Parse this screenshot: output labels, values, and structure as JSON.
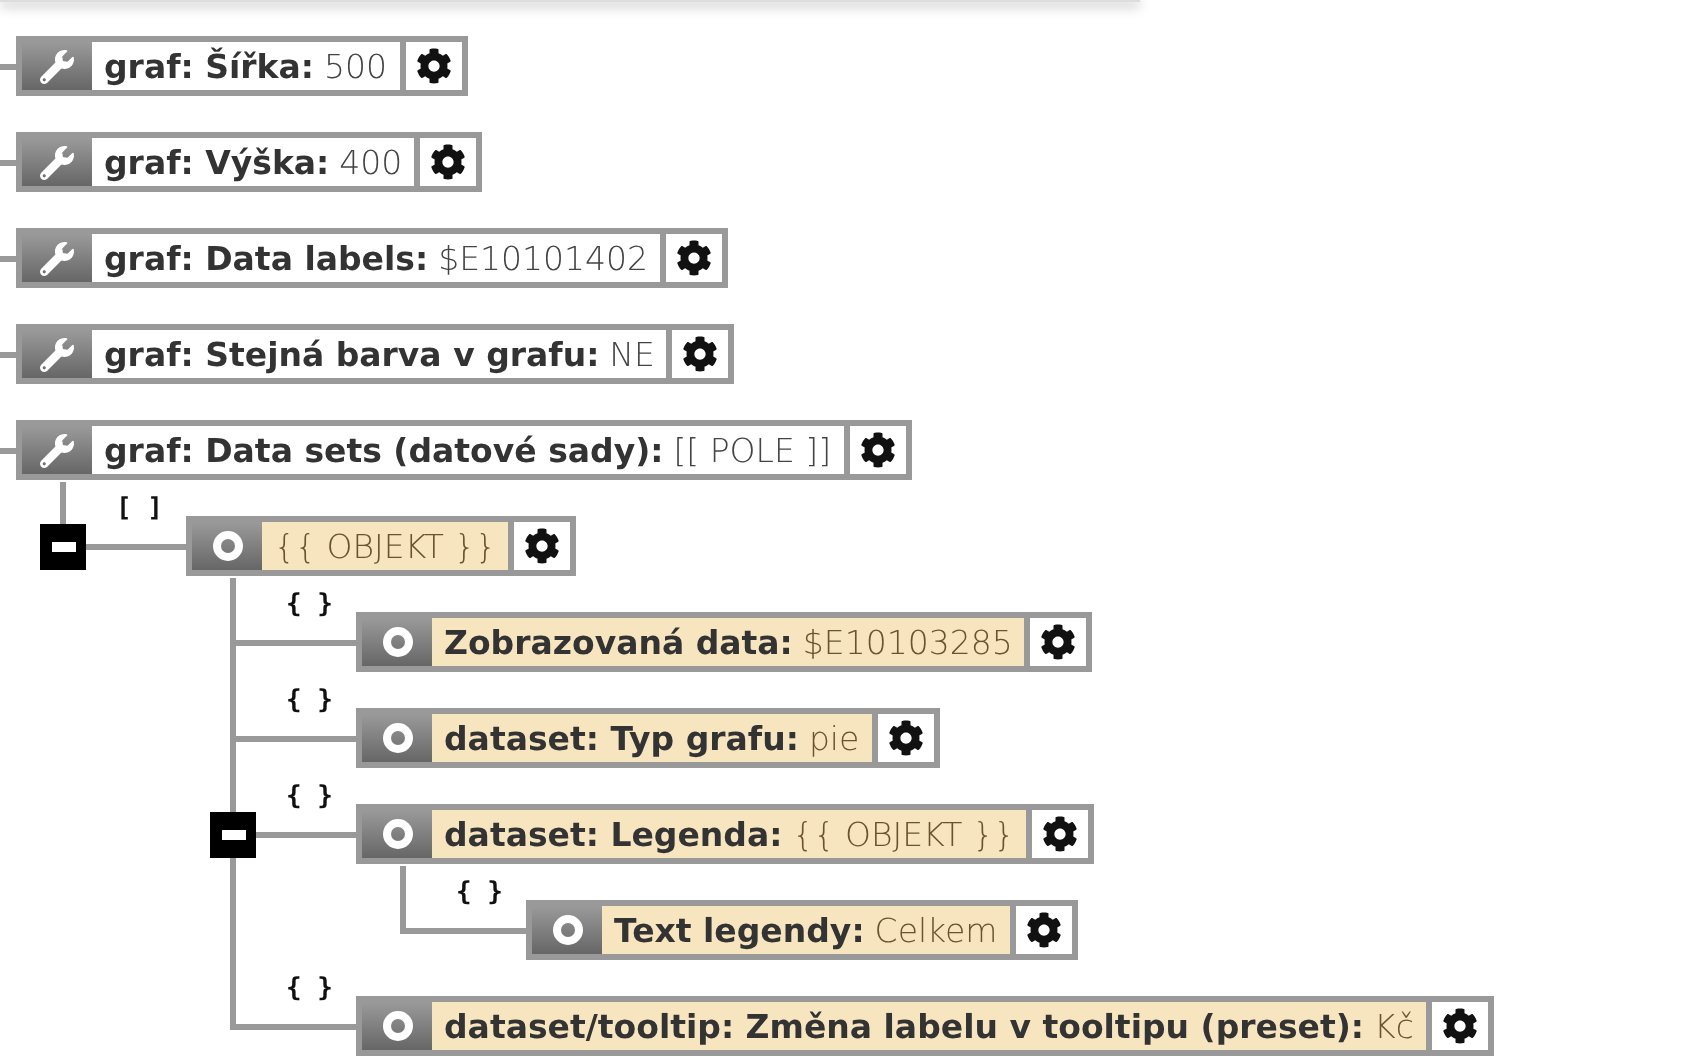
{
  "nodes": [
    {
      "kind": "setting",
      "label": "graf: Šířka:",
      "value": "500"
    },
    {
      "kind": "setting",
      "label": "graf: Výška:",
      "value": "400"
    },
    {
      "kind": "setting",
      "label": "graf: Data labels:",
      "value": "$E10101402"
    },
    {
      "kind": "setting",
      "label": "graf: Stejná barva v grafu:",
      "value": "NE"
    },
    {
      "kind": "setting",
      "label": "graf: Data sets (datové sady):",
      "value": "[[ POLE ]]",
      "children": [
        {
          "kind": "object",
          "bracket": "[ ]",
          "value": "{{ OBJEKT }}",
          "expanded": true,
          "children": [
            {
              "kind": "object",
              "bracket": "{ }",
              "label": "Zobrazovaná data:",
              "value": "$E10103285"
            },
            {
              "kind": "object",
              "bracket": "{ }",
              "label": "dataset: Typ grafu:",
              "value": "pie"
            },
            {
              "kind": "object",
              "bracket": "{ }",
              "label": "dataset: Legenda:",
              "value": "{{ OBJEKT }}",
              "expanded": true,
              "children": [
                {
                  "kind": "object",
                  "bracket": "{ }",
                  "label": "Text legendy:",
                  "value": "Celkem"
                }
              ]
            },
            {
              "kind": "object",
              "bracket": "{ }",
              "label": "dataset/tooltip: Změna labelu v tooltipu (preset):",
              "value": "Kč"
            }
          ]
        }
      ]
    }
  ]
}
